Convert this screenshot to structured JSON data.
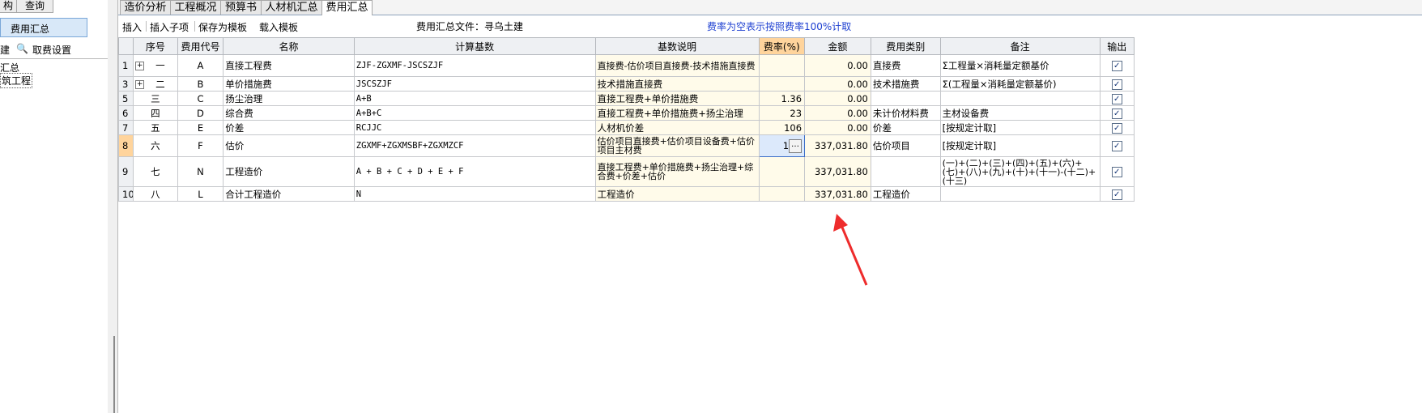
{
  "left_pane": {
    "tabs": [
      "构",
      "查询"
    ],
    "selected_item": "费用汇总",
    "toolbar": {
      "new_label": "建",
      "cancel_label": "取费设置"
    },
    "tree": [
      "汇总",
      "筑工程"
    ]
  },
  "top_tabs": [
    "造价分析",
    "工程概况",
    "预算书",
    "人材机汇总",
    "费用汇总"
  ],
  "active_tab": "费用汇总",
  "toolbar": {
    "insert": "插入",
    "insert_child": "插入子项",
    "save_template": "保存为模板",
    "load_template": "载入模板",
    "file_label": "费用汇总文件：寻乌土建",
    "note": "费率为空表示按照费率100%计取"
  },
  "grid": {
    "headers": [
      "序号",
      "费用代号",
      "名称",
      "计算基数",
      "基数说明",
      "费率(%)",
      "金额",
      "费用类别",
      "备注",
      "输出"
    ],
    "rows": [
      {
        "rownum": "1",
        "expand": "+",
        "seq": "一",
        "code": "A",
        "name": "直接工程费",
        "base": "ZJF-ZGXMF-JSCSZJF",
        "desc": "直接费-估价项目直接费-技术措施直接费",
        "rate": "",
        "amount": "0.00",
        "category": "直接费",
        "remark": "Σ工程量×消耗量定额基价",
        "output": "✓"
      },
      {
        "rownum": "3",
        "expand": "+",
        "seq": "二",
        "code": "B",
        "name": "单价措施费",
        "base": "JSCSZJF",
        "desc": "技术措施直接费",
        "rate": "",
        "amount": "0.00",
        "category": "技术措施费",
        "remark": "Σ(工程量×消耗量定额基价)",
        "output": "✓"
      },
      {
        "rownum": "5",
        "expand": "",
        "seq": "三",
        "code": "C",
        "name": "扬尘治理",
        "base": "A+B",
        "desc": "直接工程费+单价措施费",
        "rate": "1.36",
        "amount": "0.00",
        "category": "",
        "remark": "",
        "output": "✓"
      },
      {
        "rownum": "6",
        "expand": "",
        "seq": "四",
        "code": "D",
        "name": "综合费",
        "base": "A+B+C",
        "desc": "直接工程费+单价措施费+扬尘治理",
        "rate": "23",
        "amount": "0.00",
        "category": "未计价材料费",
        "remark": "主材设备费",
        "output": "✓"
      },
      {
        "rownum": "7",
        "expand": "",
        "seq": "五",
        "code": "E",
        "name": "价差",
        "base": "RCJJC",
        "desc": "人材机价差",
        "rate": "106",
        "amount": "0.00",
        "category": "价差",
        "remark": "[按规定计取]",
        "output": "✓"
      },
      {
        "rownum": "8",
        "expand": "",
        "seq": "六",
        "code": "F",
        "name": "估价",
        "base": "ZGXMF+ZGXMSBF+ZGXMZCF",
        "desc": "估价项目直接费+估价项目设备费+估价项目主材费",
        "rate": "1",
        "amount": "337,031.80",
        "category": "估价项目",
        "remark": "[按规定计取]",
        "output": "✓"
      },
      {
        "rownum": "9",
        "expand": "",
        "seq": "七",
        "code": "N",
        "name": "工程造价",
        "base": "A + B + C + D + E + F",
        "desc": "直接工程费+单价措施费+扬尘治理+综合费+价差+估价",
        "rate": "",
        "amount": "337,031.80",
        "category": "",
        "remark": "(一)+(二)+(三)+(四)+(五)+(六)+(七)+(八)+(九)+(十)+(十一)-(十二)+(十三)",
        "output": "✓"
      },
      {
        "rownum": "10",
        "expand": "",
        "seq": "八",
        "code": "L",
        "name": "合计工程造价",
        "base": "N",
        "desc": "工程造价",
        "rate": "",
        "amount": "337,031.80",
        "category": "工程造价",
        "remark": "",
        "output": "✓"
      }
    ]
  },
  "colors": {
    "accent_header": "#ffd49c",
    "note_text": "#1d3fd1",
    "arrow": "#ee2c2c"
  }
}
